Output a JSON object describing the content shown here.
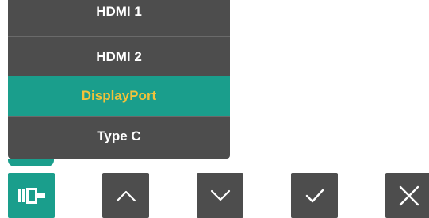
{
  "osd_menu": {
    "items": [
      {
        "label": "HDMI 1",
        "selected": false
      },
      {
        "label": "HDMI 2",
        "selected": false
      },
      {
        "label": "DisplayPort",
        "selected": true
      },
      {
        "label": "Type C",
        "selected": false
      }
    ]
  },
  "buttons": [
    {
      "icon": "input-source-icon",
      "active": true
    },
    {
      "icon": "chevron-up-icon",
      "active": false
    },
    {
      "icon": "chevron-down-icon",
      "active": false
    },
    {
      "icon": "checkmark-icon",
      "active": false
    },
    {
      "icon": "close-icon",
      "active": false
    }
  ],
  "colors": {
    "panel": "#4d4d4d",
    "accent": "#1a9e8c",
    "selected_text": "#f2c23a",
    "text": "#ffffff"
  }
}
